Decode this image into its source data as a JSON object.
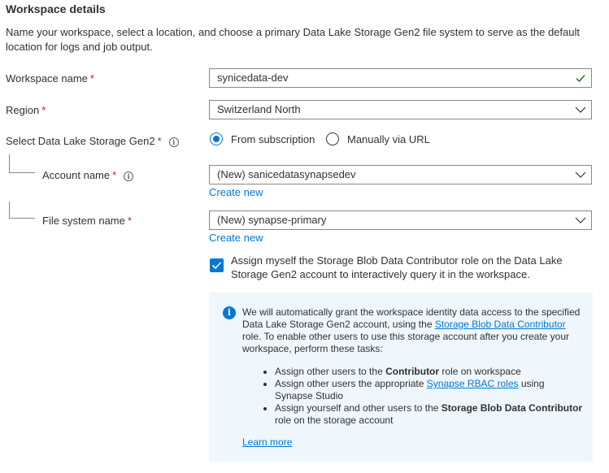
{
  "section": {
    "title": "Workspace details",
    "description": "Name your workspace, select a location, and choose a primary Data Lake Storage Gen2 file system to serve as the default location for logs and job output."
  },
  "required_marker": "*",
  "workspace_name": {
    "label": "Workspace name",
    "value": "synicedata-dev"
  },
  "region": {
    "label": "Region",
    "value": "Switzerland North"
  },
  "storage": {
    "label": "Select Data Lake Storage Gen2",
    "options": [
      "From subscription",
      "Manually via URL"
    ],
    "selected": "From subscription"
  },
  "account": {
    "label": "Account name",
    "value": "(New) sanicedatasynapsedev",
    "create_new": "Create new"
  },
  "filesystem": {
    "label": "File system name",
    "value": "(New) synapse-primary",
    "create_new": "Create new"
  },
  "assign": {
    "checked": true,
    "text": "Assign myself the Storage Blob Data Contributor role on the Data Lake Storage Gen2 account to interactively query it in the workspace."
  },
  "info": {
    "intro_1": "We will automatically grant the workspace identity data access to the specified Data Lake Storage Gen2 account, using the ",
    "intro_link": "Storage Blob Data Contributor",
    "intro_2": " role. To enable other users to use this storage account after you create your workspace, perform these tasks:",
    "bullet1_pre": "Assign other users to the ",
    "bullet1_bold": "Contributor",
    "bullet1_post": " role on workspace",
    "bullet2_pre": "Assign other users the appropriate ",
    "bullet2_link": "Synapse RBAC roles",
    "bullet2_post": " using Synapse Studio",
    "bullet3_pre": "Assign yourself and other users to the ",
    "bullet3_bold": "Storage Blob Data Contributor",
    "bullet3_post": " role on the storage account",
    "learn_more": "Learn more"
  },
  "colors": {
    "accent": "#0078d4",
    "required": "#a4262c",
    "valid": "#107c10",
    "info_bg": "#eff6fc"
  },
  "icons": {
    "info": "info-icon",
    "valid": "checkmark-icon",
    "dropdown": "chevron-down-icon"
  }
}
